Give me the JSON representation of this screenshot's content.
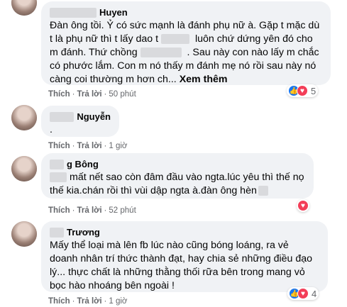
{
  "comments": [
    {
      "name": "Huyen",
      "text_parts": [
        "Đàn ông tồi. Ỷ có sức mạnh là đánh phụ nữ à. Gặp t mặc dù t là phụ nữ thì t lấy dao t",
        "luôn chứ dứng yên đó cho m đánh. Thứ chồng",
        ". Sau này con nào lấy m chắc có phước lắm. Con m nó thấy m đánh mẹ nó rồi sau này nó càng coi thường m hơn ch..."
      ],
      "see_more": "Xem thêm",
      "actions": {
        "like": "Thích",
        "reply": "Trả lời",
        "time": "50 phút"
      },
      "reaction_count": "5",
      "reactions": [
        "like-icon",
        "love-icon"
      ]
    },
    {
      "name": "Nguyễn",
      "text": ".",
      "actions": {
        "like": "Thích",
        "reply": "Trả lời",
        "time": "1 giờ"
      }
    },
    {
      "name": "g Bông",
      "text": "mất nết sao còn đâm đầu vào ngta.lúc yêu thì thế nọ thế kia.chán rồi thì vùi dập ngta à.đàn ông hèn",
      "actions": {
        "like": "Thích",
        "reply": "Trả lời",
        "time": "52 phút"
      },
      "reactions": [
        "love-icon"
      ]
    },
    {
      "name": "Trương",
      "text": "Mấy thể loại mà lên fb lúc nào cũng bóng loáng, ra vẻ doanh nhân trí thức thành đạt, hay chia sẻ những điều đạo lý... thực chất là những thằng thối rữa bên trong mang vỏ bọc hào nhoáng bên ngoài !",
      "actions": {
        "like": "Thích",
        "reply": "Trả lời",
        "time": "1 giờ"
      },
      "reaction_count": "4",
      "reactions": [
        "like-icon",
        "love-icon"
      ]
    }
  ],
  "separator": "·",
  "colors": {
    "bubble": "#f0f2f5",
    "like": "#1877f2",
    "love": "#f33e58",
    "meta": "#65676b"
  }
}
